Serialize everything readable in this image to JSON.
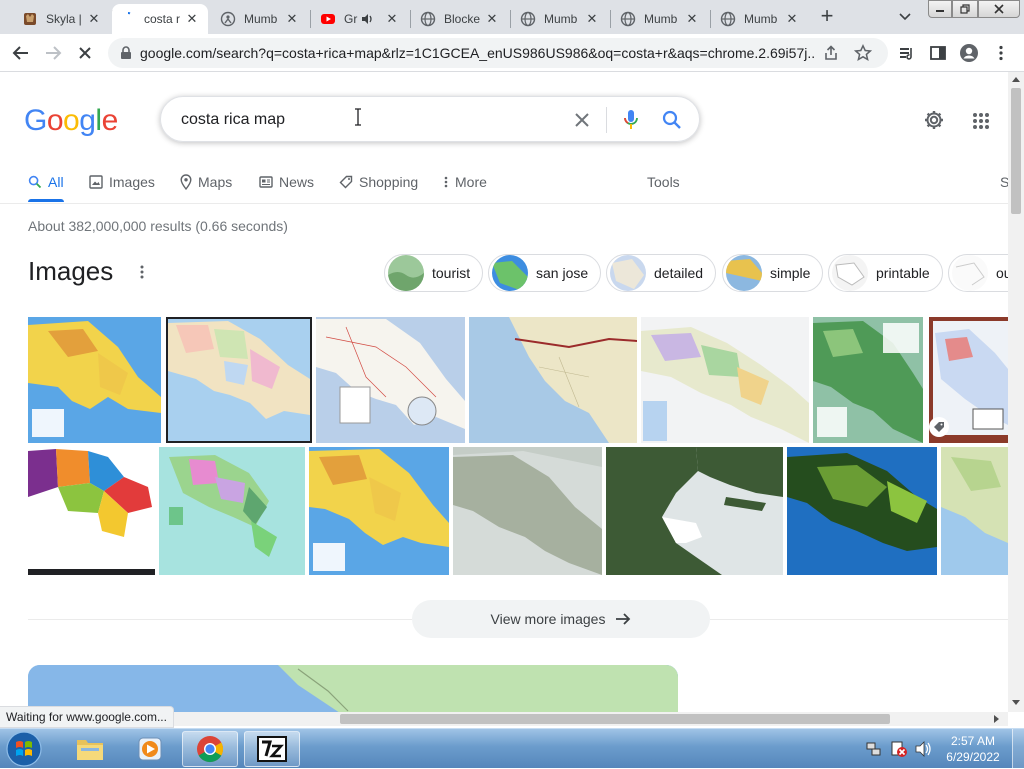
{
  "browser": {
    "tabs": [
      {
        "label": "Skyla |",
        "icon": "wolf-favicon",
        "active": false
      },
      {
        "label": "costa r",
        "icon": "google-favicon",
        "active": true
      },
      {
        "label": "Mumb",
        "icon": "globe-person-favicon",
        "active": false
      },
      {
        "label": "Gr",
        "icon": "youtube-favicon",
        "active": false
      },
      {
        "label": "Blocke",
        "icon": "globe-favicon",
        "active": false
      },
      {
        "label": "Mumb",
        "icon": "globe-favicon",
        "active": false
      },
      {
        "label": "Mumb",
        "icon": "globe-favicon",
        "active": false
      },
      {
        "label": "Mumb",
        "icon": "globe-favicon",
        "active": false
      }
    ],
    "new_tab": "+",
    "url": "google.com/search?q=costa+rica+map&rlz=1C1GCEA_enUS986US986&oq=costa+r&aqs=chrome.2.69i57j...",
    "status_text": "Waiting for www.google.com..."
  },
  "google": {
    "logo": [
      "G",
      "o",
      "o",
      "g",
      "l",
      "e"
    ],
    "logo_colors": [
      "#4285f4",
      "#ea4335",
      "#fbbc05",
      "#4285f4",
      "#34a853",
      "#ea4335"
    ],
    "query": "costa rica map",
    "nav": {
      "all": "All",
      "images": "Images",
      "maps": "Maps",
      "news": "News",
      "shopping": "Shopping",
      "more": "More",
      "tools": "Tools",
      "cutoff": "S"
    },
    "stats": "About 382,000,000 results (0.66 seconds)",
    "images_heading": "Images",
    "chips": [
      "tourist",
      "san jose",
      "detailed",
      "simple",
      "printable",
      "ou"
    ],
    "view_more": "View more images",
    "accent": "#1a73e8"
  },
  "taskbar": {
    "time": "2:57 AM",
    "date": "6/29/2022"
  }
}
